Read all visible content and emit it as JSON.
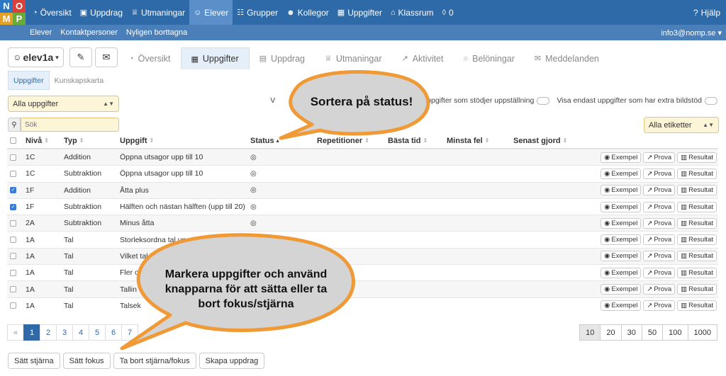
{
  "logo_letters": [
    "N",
    "O",
    "M",
    "P"
  ],
  "topnav": {
    "items": [
      {
        "label": "Översikt",
        "icon": "dashboard-icon"
      },
      {
        "label": "Uppdrag",
        "icon": "clipboard-icon"
      },
      {
        "label": "Utmaningar",
        "icon": "trophy-icon"
      },
      {
        "label": "Elever",
        "icon": "user-icon"
      },
      {
        "label": "Grupper",
        "icon": "group-icon"
      },
      {
        "label": "Kollegor",
        "icon": "users-icon"
      },
      {
        "label": "Uppgifter",
        "icon": "grid-icon"
      },
      {
        "label": "Klassrum",
        "icon": "classroom-icon"
      },
      {
        "label": "0",
        "icon": "bell-icon"
      }
    ],
    "help_label": "Hjälp",
    "active": "Elever"
  },
  "subnav": {
    "items": [
      "Elever",
      "Kontaktpersoner",
      "Nyligen borttagna"
    ],
    "user": "info3@nomp.se"
  },
  "student": {
    "name": "elev1a"
  },
  "tabs": [
    {
      "label": "Översikt",
      "icon": "dashboard-icon"
    },
    {
      "label": "Uppgifter",
      "icon": "table-icon"
    },
    {
      "label": "Uppdrag",
      "icon": "document-icon"
    },
    {
      "label": "Utmaningar",
      "icon": "trophy-icon"
    },
    {
      "label": "Aktivitet",
      "icon": "chart-line-icon"
    },
    {
      "label": "Belöningar",
      "icon": "circle-icon"
    },
    {
      "label": "Meddelanden",
      "icon": "envelope-icon"
    }
  ],
  "active_tab": "Uppgifter",
  "subtabs": [
    "Uppgifter",
    "Kunskapskarta"
  ],
  "filter": {
    "selected": "Alla uppgifter"
  },
  "toggles": {
    "prefix": "V",
    "opt1": "uppgifter som stödjer uppställning",
    "opt2": "Visa endast uppgifter som har extra bildstöd"
  },
  "search": {
    "placeholder": "Sök"
  },
  "tags": {
    "selected": "Alla etiketter"
  },
  "columns": {
    "level": "Nivå",
    "type": "Typ",
    "task": "Uppgift",
    "status": "Status",
    "reps": "Repetitioner",
    "best": "Bästa tid",
    "least": "Minsta fel",
    "last": "Senast gjord"
  },
  "rows": [
    {
      "level": "1C",
      "type": "Addition",
      "task": "Öppna utsagor upp till 10",
      "checked": false,
      "status": true
    },
    {
      "level": "1C",
      "type": "Subtraktion",
      "task": "Öppna utsagor upp till 10",
      "checked": false,
      "status": true
    },
    {
      "level": "1F",
      "type": "Addition",
      "task": "Åtta plus",
      "checked": true,
      "status": true
    },
    {
      "level": "1F",
      "type": "Subtraktion",
      "task": "Hälften och nästan hälften (upp till 20)",
      "checked": true,
      "status": true
    },
    {
      "level": "2A",
      "type": "Subtraktion",
      "task": "Minus åtta",
      "checked": false,
      "status": true
    },
    {
      "level": "1A",
      "type": "Tal",
      "task": "Storleksordna tal upp till 10",
      "checked": false,
      "status": false
    },
    {
      "level": "1A",
      "type": "Tal",
      "task": "Vilket tal är lä",
      "checked": false,
      "status": false
    },
    {
      "level": "1A",
      "type": "Tal",
      "task": "Fler oc",
      "checked": false,
      "status": false
    },
    {
      "level": "1A",
      "type": "Tal",
      "task": "Tallin",
      "checked": false,
      "status": false
    },
    {
      "level": "1A",
      "type": "Tal",
      "task": "Talsek",
      "checked": false,
      "status": false
    }
  ],
  "row_actions": {
    "example": "Exempel",
    "try": "Prova",
    "result": "Resultat"
  },
  "pagination": {
    "prev": "«",
    "pages": [
      "1",
      "2",
      "3",
      "4",
      "5",
      "6",
      "7"
    ],
    "active": "1"
  },
  "page_sizes": {
    "options": [
      "10",
      "20",
      "30",
      "50",
      "100",
      "1000"
    ],
    "active": "10"
  },
  "bottom_buttons": [
    "Sätt stjärna",
    "Sätt fokus",
    "Ta bort stjärna/fokus",
    "Skapa uppdrag"
  ],
  "callouts": {
    "status": "Sortera på status!",
    "mark": [
      "Markera uppgifter och använd",
      "knapparna för att sätta eller ta",
      "bort fokus/stjärna"
    ]
  },
  "colors": {
    "nav": "#2f6aa8",
    "subnav": "#4b7fb9",
    "logo": [
      "#2b78c4",
      "#d9413a",
      "#e3a126",
      "#6aaa3c"
    ],
    "bubble_fill": "#d4d4d4",
    "bubble_stroke": "#ef9a36"
  }
}
